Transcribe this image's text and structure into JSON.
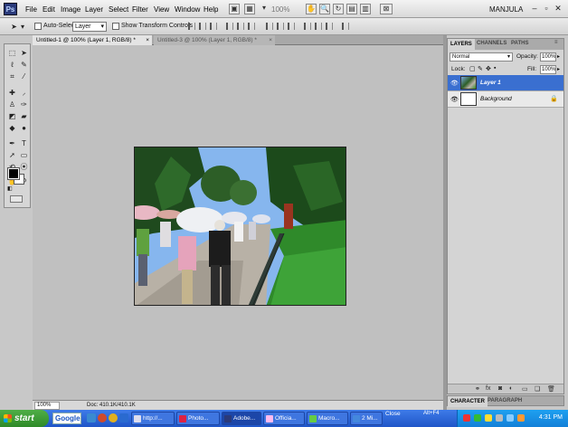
{
  "app": {
    "logo": "Ps",
    "menu": [
      "File",
      "Edit",
      "Image",
      "Layer",
      "Select",
      "Filter",
      "View",
      "Window",
      "Help"
    ],
    "zoom_level": "100%",
    "workspace": "MANJULA"
  },
  "options_bar": {
    "auto_select_label": "Auto-Select:",
    "auto_select_value": "Layer",
    "show_transform_label": "Show Transform Controls"
  },
  "tabs": [
    {
      "label": "Untitled-1 @ 100% (Layer 1, RGB/8) *",
      "active": true
    },
    {
      "label": "Untitled-3 @ 100% (Layer 1, RGB/8) *",
      "active": false
    }
  ],
  "status": {
    "zoom": "100%",
    "doc": "Doc: 410.1K/410.1K"
  },
  "layers_panel": {
    "tabs": [
      "LAYERS",
      "CHANNELS",
      "PATHS"
    ],
    "blend_mode": "Normal",
    "opacity_label": "Opacity:",
    "opacity_value": "100%",
    "lock_label": "Lock:",
    "fill_label": "Fill:",
    "fill_value": "100%",
    "layers": [
      {
        "name": "Layer 1",
        "selected": true
      },
      {
        "name": "Background",
        "selected": false
      }
    ]
  },
  "bottom_panel_tabs": [
    "CHARACTER",
    "PARAGRAPH"
  ],
  "taskbar": {
    "start_label": "start",
    "search_label": "Google",
    "buttons": [
      {
        "label": "http://..."
      },
      {
        "label": "Photo..."
      },
      {
        "label": "Adobe..."
      },
      {
        "label": "Officia..."
      },
      {
        "label": "Macro..."
      },
      {
        "label": "2 Mi..."
      }
    ],
    "close_tip": "Close",
    "alt_tip": "Alt+F4",
    "clock": "4:31 PM"
  },
  "colors": {
    "selected_layer": "#3a6fd0",
    "taskbar": "#2a5fd6",
    "start_button": "#3e9a35"
  }
}
